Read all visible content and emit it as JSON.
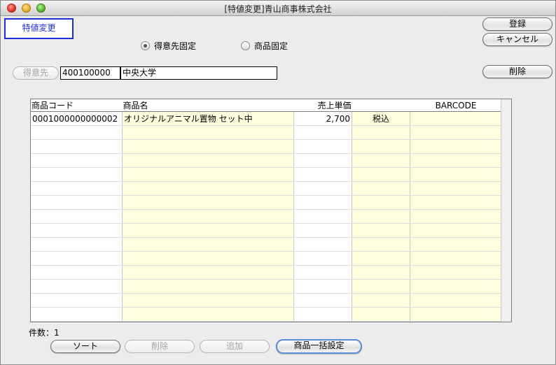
{
  "window": {
    "title": "[特値変更]青山商事株式会社"
  },
  "mode_label": "特値変更",
  "radio": [
    {
      "label": "得意先固定",
      "selected": true
    },
    {
      "label": "商品固定",
      "selected": false
    }
  ],
  "buttons": {
    "register": "登録",
    "cancel": "キャンセル",
    "delete_top": "削除",
    "customer": "得意先",
    "sort": "ソート",
    "delete_bottom": "削除",
    "add": "追加",
    "bulk_set": "商品一括設定"
  },
  "customer": {
    "code": "400100000",
    "name": "中央大学"
  },
  "table": {
    "columns": [
      "商品コード",
      "商品名",
      "売上単価",
      "",
      "BARCODE"
    ],
    "rows": [
      [
        "0001000000000002",
        "オリジナルアニマル置物 セット中",
        "2,700",
        "税込",
        ""
      ]
    ],
    "empty_rows": 14
  },
  "count": {
    "label": "件数：",
    "value": "1"
  }
}
